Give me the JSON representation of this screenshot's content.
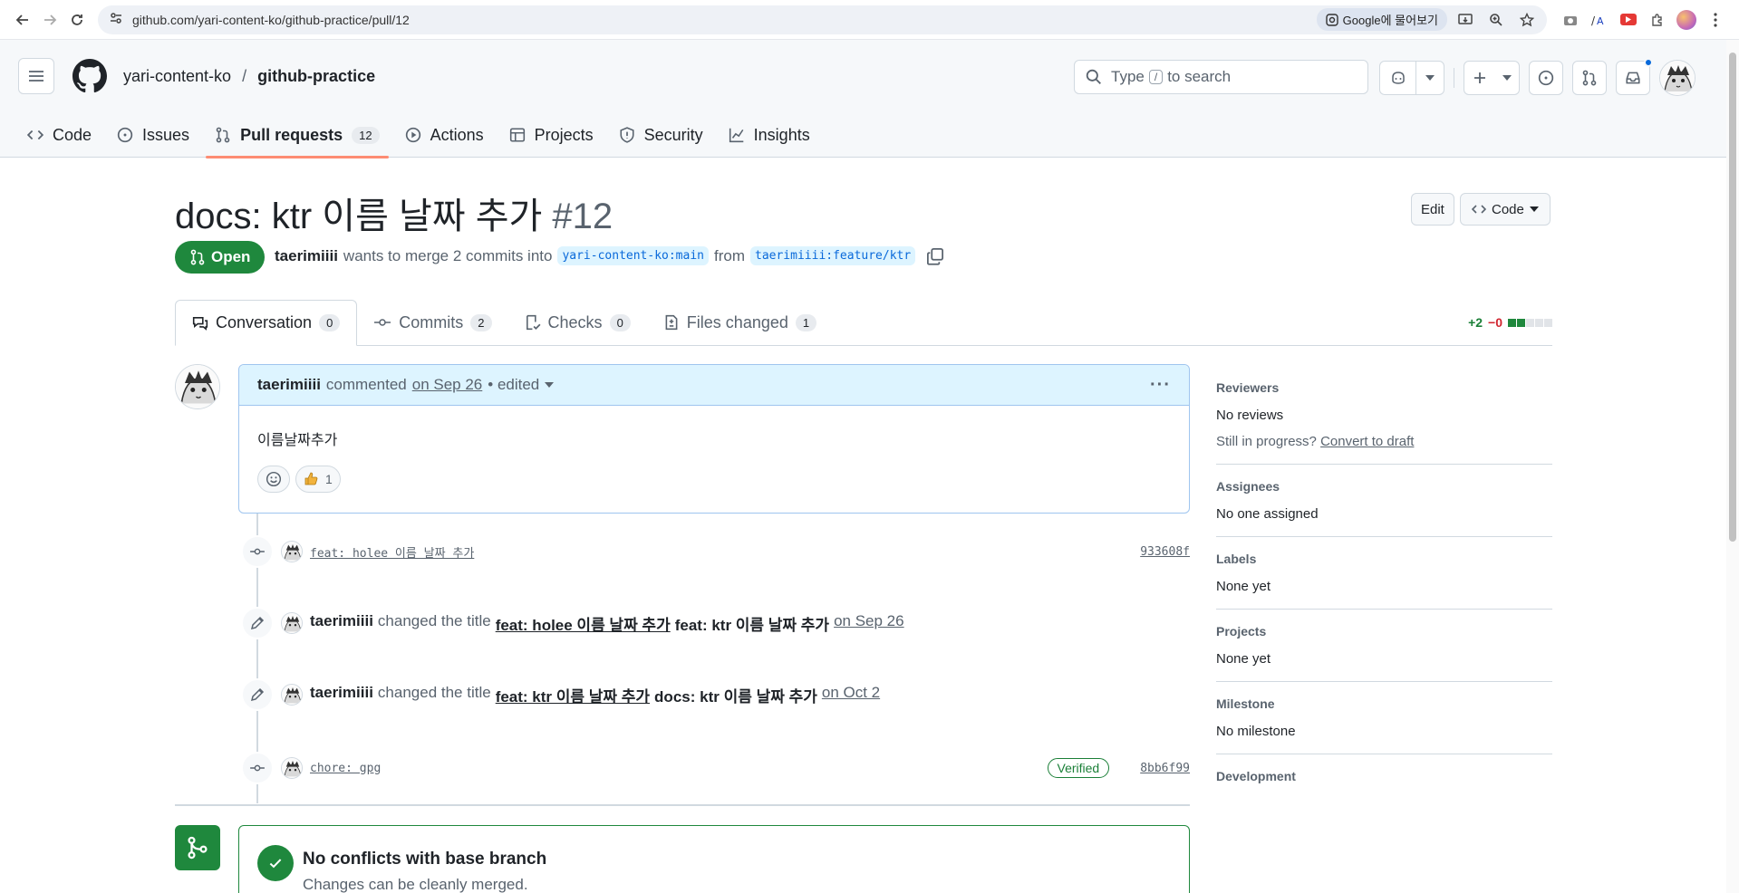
{
  "browser": {
    "url": "github.com/yari-content-ko/github-practice/pull/12",
    "google_chip": "Google에 물어보기"
  },
  "header": {
    "owner": "yari-content-ko",
    "separator": "/",
    "repo": "github-practice",
    "search_pre": "Type",
    "search_key": "/",
    "search_post": "to search"
  },
  "repo_nav": {
    "code": "Code",
    "issues": "Issues",
    "pulls": "Pull requests",
    "pulls_count": "12",
    "actions": "Actions",
    "projects": "Projects",
    "security": "Security",
    "insights": "Insights"
  },
  "pr": {
    "title": "docs: ktr 이름 날짜 추가",
    "number": "#12",
    "edit_label": "Edit",
    "code_label": "Code",
    "state": "Open",
    "author": "taerimiiii",
    "merge_text": "wants to merge 2 commits into",
    "base": "yari-content-ko:main",
    "from": "from",
    "head": "taerimiiii:feature/ktr"
  },
  "tabs": {
    "conversation": "Conversation",
    "conversation_count": "0",
    "commits": "Commits",
    "commits_count": "2",
    "checks": "Checks",
    "checks_count": "0",
    "files": "Files changed",
    "files_count": "1",
    "additions": "+2",
    "deletions": "−0"
  },
  "comment": {
    "author": "taerimiiii",
    "verb": "commented",
    "date": "on Sep 26",
    "edited": "• edited",
    "body": "이름날짜추가",
    "reaction_count": "1"
  },
  "timeline": {
    "commit1_msg": "feat: holee 이름 날짜 추가",
    "commit1_sha": "933608f",
    "event1_actor": "taerimiiii",
    "event1_verb": "changed the title",
    "event1_old": "feat: holee 이름 날짜 추가",
    "event1_new": "feat: ktr 이름 날짜 추가",
    "event1_date": "on Sep 26",
    "event2_actor": "taerimiiii",
    "event2_verb": "changed the title",
    "event2_old": "feat: ktr 이름 날짜 추가",
    "event2_new": "docs: ktr 이름 날짜 추가",
    "event2_date": "on Oct 2",
    "commit2_msg": "chore: gpg",
    "commit2_verified": "Verified",
    "commit2_sha": "8bb6f99"
  },
  "merge": {
    "title": "No conflicts with base branch",
    "subtitle": "Changes can be cleanly merged."
  },
  "sidebar": {
    "reviewers_h": "Reviewers",
    "reviewers_v": "No reviews",
    "in_progress": "Still in progress?",
    "convert": "Convert to draft",
    "assignees_h": "Assignees",
    "assignees_v": "No one assigned",
    "labels_h": "Labels",
    "labels_v": "None yet",
    "projects_h": "Projects",
    "projects_v": "None yet",
    "milestone_h": "Milestone",
    "milestone_v": "No milestone",
    "development_h": "Development"
  },
  "colors": {
    "open_green": "#1f883d",
    "link_blue": "#0969da",
    "tab_underline": "#fd8c73"
  }
}
